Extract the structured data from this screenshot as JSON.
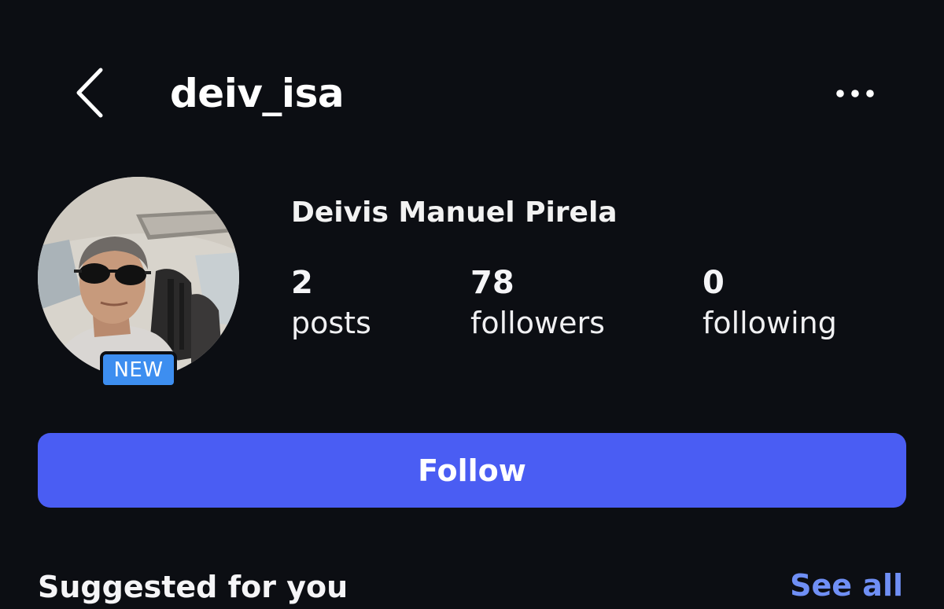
{
  "header": {
    "back_icon": "chevron-left-icon",
    "username": "deiv_isa",
    "more_icon": "ellipsis-horizontal-icon"
  },
  "profile": {
    "avatar_alt": "Profile photo",
    "badge": "NEW",
    "full_name": "Deivis Manuel Pirela",
    "stats": {
      "posts": {
        "count": "2",
        "label": "posts"
      },
      "followers": {
        "count": "78",
        "label": "followers"
      },
      "following": {
        "count": "0",
        "label": "following"
      }
    }
  },
  "actions": {
    "follow_label": "Follow"
  },
  "suggested": {
    "title": "Suggested for you",
    "see_all_label": "See all"
  },
  "colors": {
    "background": "#0c0e13",
    "follow_button": "#4a5df3",
    "badge": "#3d8ef0",
    "link": "#6f8ff5",
    "text": "#f5f5f7"
  }
}
